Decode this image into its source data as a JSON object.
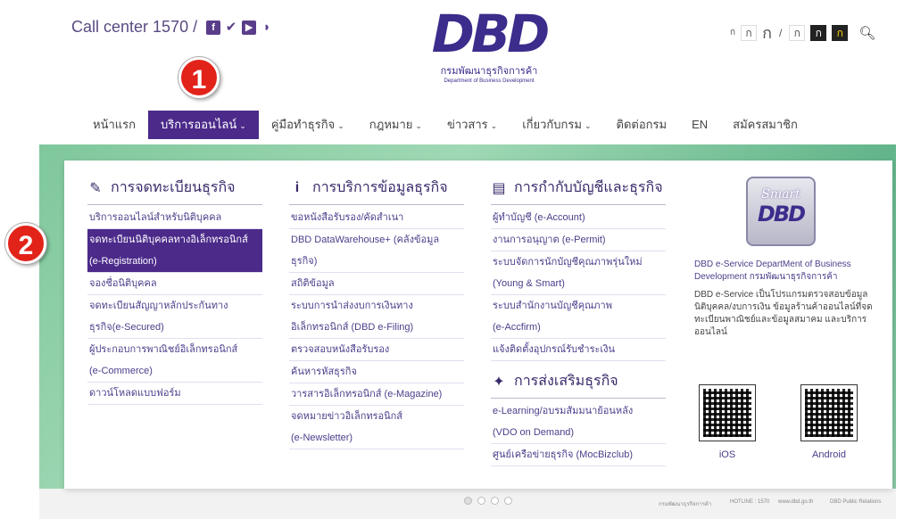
{
  "header": {
    "call_center": "Call center 1570 /",
    "social_icons": [
      "facebook-icon",
      "twitter-icon",
      "youtube-icon",
      "rss-icon"
    ],
    "logo_mark": "DBD",
    "logo_th": "กรมพัฒนาธุรกิจการค้า",
    "logo_en": "Department of Business Development",
    "font_sizes": [
      "ก",
      "ก",
      "ก"
    ],
    "contrast_options": [
      "ก",
      "ก",
      "ก"
    ]
  },
  "badges": {
    "one": "1",
    "two": "2"
  },
  "nav": {
    "items": [
      {
        "label": "หน้าแรก",
        "caret": ""
      },
      {
        "label": "บริการออนไลน์",
        "caret": "⌄"
      },
      {
        "label": "คู่มือทำธุรกิจ",
        "caret": "⌄"
      },
      {
        "label": "กฎหมาย",
        "caret": "⌄"
      },
      {
        "label": "ข่าวสาร",
        "caret": "⌄"
      },
      {
        "label": "เกี่ยวกับกรม",
        "caret": "⌄"
      },
      {
        "label": "ติดต่อกรม",
        "caret": ""
      },
      {
        "label": "EN",
        "caret": ""
      },
      {
        "label": "สมัครสมาชิก",
        "caret": ""
      }
    ]
  },
  "menu": {
    "col1": {
      "title": "การจดทะเบียนธุรกิจ",
      "links": [
        "บริการออนไลน์สำหรับนิติบุคคล",
        "จดทะเบียนนิติบุคคลทางอิเล็กทรอนิกส์",
        "(e-Registration)",
        "จองชื่อนิติบุคคล",
        "จดทะเบียนสัญญาหลักประกันทาง",
        "ธุรกิจ(e-Secured)",
        "ผู้ประกอบการพาณิชย์อิเล็กทรอนิกส์",
        "(e-Commerce)",
        "ดาวน์โหลดแบบฟอร์ม"
      ]
    },
    "col2": {
      "title": "การบริการข้อมูลธุรกิจ",
      "links": [
        "ขอหนังสือรับรอง/คัดสำเนา",
        "DBD DataWarehouse+ (คลังข้อมูล",
        "ธุรกิจ)",
        "สถิติข้อมูล",
        "ระบบการนำส่งงบการเงินทาง",
        "อิเล็กทรอนิกส์ (DBD e-Filing)",
        "ตรวจสอบหนังสือรับรอง",
        "ค้นหารหัสธุรกิจ",
        "วารสารอิเล็กทรอนิกส์ (e-Magazine)",
        "จดหมายข่าวอิเล็กทรอนิกส์",
        "(e-Newsletter)"
      ]
    },
    "col3": {
      "title": "การกำกับบัญชีและธุรกิจ",
      "links": [
        "ผู้ทำบัญชี (e-Account)",
        "งานการอนุญาต (e-Permit)",
        "ระบบจัดการนักบัญชีคุณภาพรุ่นใหม่",
        "(Young & Smart)",
        "ระบบสำนักงานบัญชีคุณภาพ",
        "(e-Accfirm)",
        "แจ้งติดตั้งอุปกรณ์รับชำระเงิน"
      ],
      "sub_title": "การส่งเสริมธุรกิจ",
      "sub_links": [
        "e-Learning/อบรมสัมมนาย้อนหลัง",
        "(VDO on Demand)",
        "ศูนย์เครือข่ายธุรกิจ (MocBizclub)"
      ]
    },
    "col4": {
      "smart_1": "Smart",
      "smart_2": "DBD",
      "title": "DBD e-Service DepartMent of Business Development กรมพัฒนาธุรกิจการค้า",
      "desc": "DBD e-Service เป็นโปรแกรมตรวจสอบข้อมูลนิติบุคคล/งบการเงิน ข้อมูลร้านค้าออนไลน์ที่จดทะเบียนพาณิชย์และข้อมูลสมาคม และบริการออนไลน์",
      "ios": "iOS",
      "android": "Android"
    }
  },
  "footer": {
    "hotline": "HOTLINE : 1570",
    "site": "www.dbd.go.th",
    "pr": "DBD Public Relations",
    "dept": "กรมพัฒนาธุรกิจการค้า"
  },
  "colors": {
    "brand_purple": "#4b2a8a",
    "badge_red": "#e2231a"
  }
}
